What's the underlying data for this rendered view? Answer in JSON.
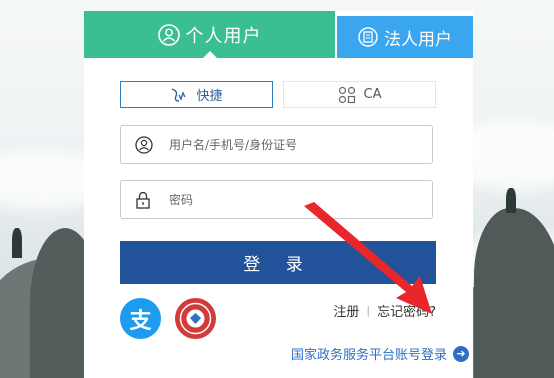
{
  "tabs": {
    "personal": "个人用户",
    "legal": "法人用户"
  },
  "modes": {
    "quick": "快捷",
    "ca": "CA"
  },
  "fields": {
    "username_placeholder": "用户名/手机号/身份证号",
    "password_placeholder": "密码"
  },
  "login_button": "登 录",
  "alipay_label": "支",
  "links": {
    "register": "注册",
    "forgot": "忘记密码?",
    "gov_platform": "国家政务服务平台账号登录"
  },
  "colors": {
    "tab_personal": "#3bbf92",
    "tab_legal": "#3aa6ef",
    "login": "#21529a",
    "alipay": "#1c9bef",
    "annotation": "#e8262c"
  }
}
